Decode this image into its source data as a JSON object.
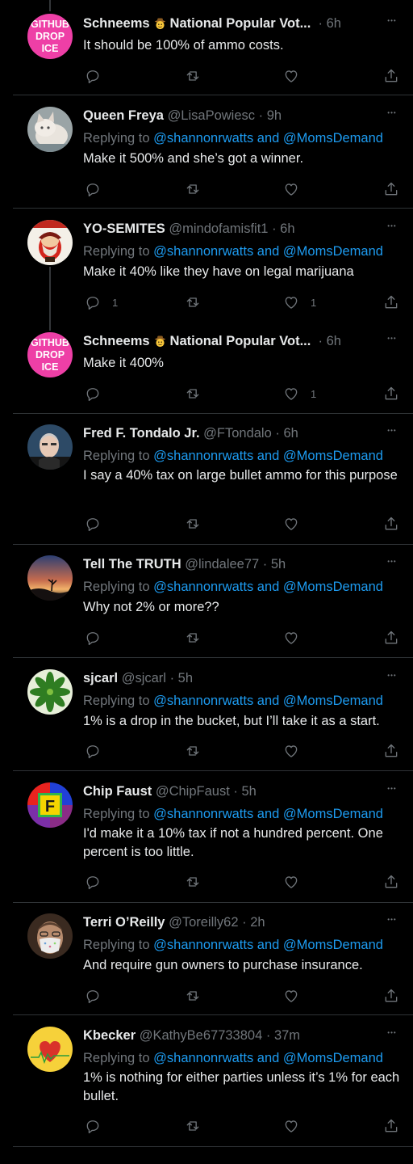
{
  "feed": {
    "tweets": [
      {
        "name": "Schneems",
        "name_suffix": "National Popular Vot...",
        "cowboy": true,
        "handle": "",
        "time": "6h",
        "avatar": "githubdropice",
        "reply_to": null,
        "text": "It should be 100% of ammo costs.",
        "replies": "",
        "retweets": "",
        "likes": ""
      },
      {
        "name": "Queen Freya",
        "handle": "@LisaPowiesc",
        "time": "9h",
        "avatar": "cat",
        "reply_prefix": "Replying to ",
        "reply_to": "@shannonrwatts and @MomsDemand",
        "text": "Make it 500% and she’s got a winner.",
        "replies": "",
        "retweets": "",
        "likes": ""
      },
      {
        "name": "YO-SEMITES",
        "handle": "@mindofamisfit1",
        "time": "6h",
        "avatar": "yosemite",
        "reply_prefix": "Replying to ",
        "reply_to": "@shannonrwatts and @MomsDemand",
        "text": "Make it 40% like they have on legal marijuana",
        "replies": "1",
        "retweets": "",
        "likes": "1"
      },
      {
        "name": "Schneems",
        "name_suffix": "National Popular Vot...",
        "cowboy": true,
        "handle": "",
        "time": "6h",
        "avatar": "githubdropice",
        "reply_to": null,
        "text": "Make it 400%",
        "replies": "",
        "retweets": "",
        "likes": "1"
      },
      {
        "name": "Fred F. Tondalo Jr.",
        "handle": "@FTondalo",
        "time": "6h",
        "avatar": "man",
        "reply_prefix": "Replying to ",
        "reply_to": "@shannonrwatts and @MomsDemand",
        "text": "I say a 40% tax on large bullet ammo for this purpose",
        "replies": "",
        "retweets": "",
        "likes": ""
      },
      {
        "name": "Tell The TRUTH",
        "handle": "@lindalee77",
        "time": "5h",
        "avatar": "sunset",
        "reply_prefix": "Replying to ",
        "reply_to": "@shannonrwatts and @MomsDemand",
        "text": "Why not 2% or more??",
        "replies": "",
        "retweets": "",
        "likes": ""
      },
      {
        "name": "sjcarl",
        "handle": "@sjcarl",
        "time": "5h",
        "avatar": "plant",
        "reply_prefix": "Replying to ",
        "reply_to": "@shannonrwatts and @MomsDemand",
        "text": "1% is a drop in the bucket, but I’ll take it as a start.",
        "replies": "",
        "retweets": "",
        "likes": ""
      },
      {
        "name": "Chip Faust",
        "handle": "@ChipFaust",
        "time": "5h",
        "avatar": "faust",
        "reply_prefix": "Replying to ",
        "reply_to": "@shannonrwatts and @MomsDemand",
        "text": "I'd make it a 10% tax if not a hundred percent. One percent is too little.",
        "replies": "",
        "retweets": "",
        "likes": ""
      },
      {
        "name": "Terri O’Reilly",
        "handle": "@Toreilly62",
        "time": "2h",
        "avatar": "mask",
        "reply_prefix": "Replying to ",
        "reply_to": "@shannonrwatts and @MomsDemand",
        "text": "And require gun owners to purchase insurance.",
        "replies": "",
        "retweets": "",
        "likes": ""
      },
      {
        "name": "Kbecker",
        "handle": "@KathyBe67733804",
        "time": "37m",
        "avatar": "heart",
        "reply_prefix": "Replying to ",
        "reply_to": "@shannonrwatts and @MomsDemand",
        "text": "1% is nothing for either parties unless it’s 1% for each bullet.",
        "replies": "",
        "retweets": "",
        "likes": ""
      }
    ]
  },
  "avatar_text": {
    "githubdropice": [
      "GITHUB",
      "DROP",
      "ICE"
    ],
    "faust": "F"
  },
  "colors": {
    "background": "#000000",
    "text": "#e7e9ea",
    "muted": "#71767b",
    "link": "#1d9bf0",
    "divider": "#2f3336",
    "githubdropice_pink": "#ee3fa6"
  }
}
